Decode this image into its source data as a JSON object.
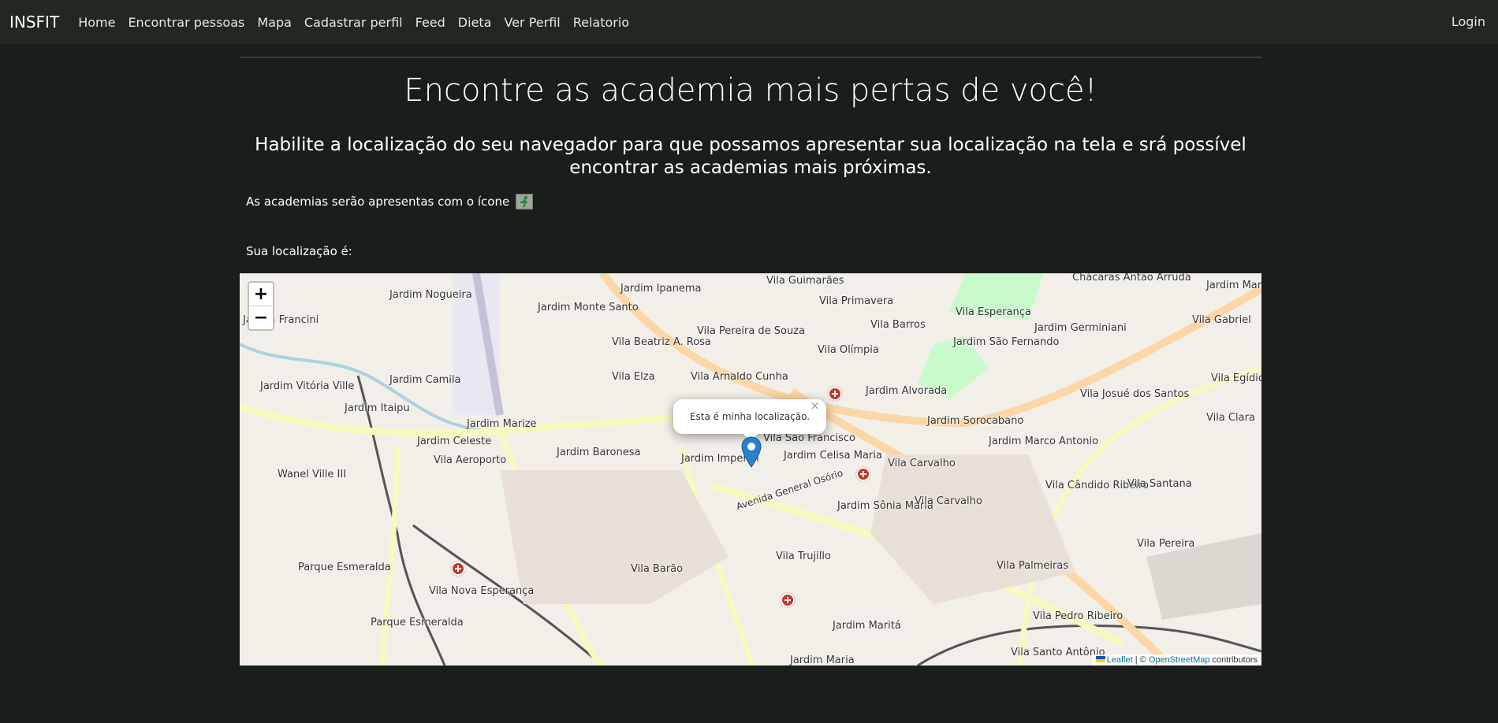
{
  "nav": {
    "brand": "INSFIT",
    "items": [
      "Home",
      "Encontrar pessoas",
      "Mapa",
      "Cadastrar perfil",
      "Feed",
      "Dieta",
      "Ver Perfil",
      "Relatorio"
    ],
    "login": "Login"
  },
  "main": {
    "title": "Encontre as academia mais pertas de você!",
    "subtitle": "Habilite a localização do seu navegador para que possamos apresentar sua localização na tela e srá possível encontrar as academias mais próximas.",
    "note": "As academias serão apresentas com o ícone",
    "location_label": "Sua localização é:"
  },
  "map": {
    "zoom_in": "+",
    "zoom_out": "−",
    "popup_text": "Esta é minha localização.",
    "popup_close": "×",
    "labels": [
      "Jardim Ipanema",
      "Vila Guimarães",
      "Chácaras Antão Arruda",
      "Jardim Maria do Carmo",
      "Jardim Nogueira",
      "Jardim Monte Santo",
      "Vila Primavera",
      "Vila Esperança",
      "Jardim Francini",
      "Vila Beatriz A. Rosa",
      "Vila Pereira de Souza",
      "Vila Barros",
      "Jardim Germiniani",
      "Vila Gabriel",
      "Jardim São Fernando",
      "Vila Olímpia",
      "Jardim Camila",
      "Vila Elza",
      "Vila Arnaldo Cunha",
      "Jardim Alvorada",
      "Vila Egídio",
      "Jardim Vitória Ville",
      "Jardim Itaipu",
      "Vila Josué dos Santos",
      "Jardim Marize",
      "Jardim Sorocabano",
      "Vila Clara",
      "Jardim Celeste",
      "Vila São Francisco",
      "Jardim Marco Antonio",
      "Vila Aeroporto",
      "Jardim Baronesa",
      "Jardim Imperial",
      "Jardim Celisa Maria",
      "Vila Carvalho",
      "Wanel Ville III",
      "Vila Cândido Ribeiro",
      "Vila Santana",
      "Jardim Sônia Maria",
      "Vila Carvalho",
      "Parque Esmeralda",
      "Vila Barão",
      "Vila Trujillo",
      "Vila Pereira",
      "Vila Nova Esperança",
      "Vila Palmeiras",
      "Parque Esmeralda",
      "Jardim Maritá",
      "Vila Pedro Ribeiro",
      "Avenida General Osório",
      "Vila Santo Antônio",
      "Jardim Maria"
    ],
    "attribution_leaflet": "Leaflet",
    "attribution_sep": " | © ",
    "attribution_osm": "OpenStreetMap",
    "attribution_tail": " contributors",
    "colors": {
      "land": "#f2efe9",
      "major_road": "#f7fabf",
      "primary_road": "#fcd6a4",
      "water": "#aad3df",
      "park": "#c8facc",
      "popup_bg": "#ffffff",
      "gym_marker": "#c0392b",
      "user_marker": "#2a81cb"
    }
  }
}
